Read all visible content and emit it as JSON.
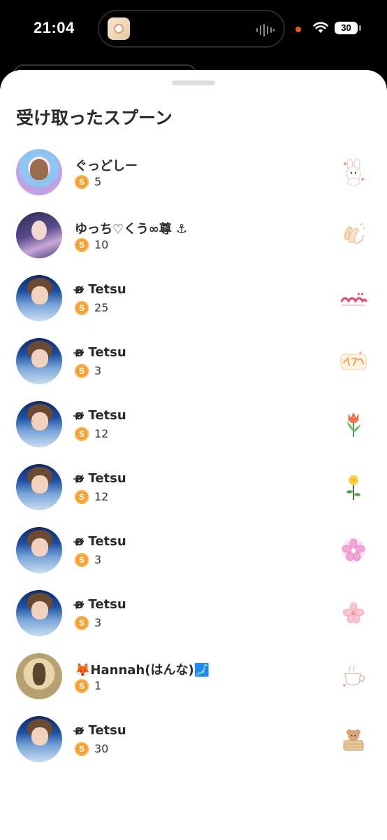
{
  "status_bar": {
    "time": "21:04",
    "battery": "30",
    "icons": [
      "app-icon",
      "audio-wave-icon",
      "recording-dot-icon",
      "wifi-icon",
      "battery-icon"
    ]
  },
  "sheet": {
    "title": "受け取ったスプーン",
    "items": [
      {
        "name": "ぐっどしー",
        "amount": "5",
        "avatar": "otter",
        "sticker": "bunny-sticker"
      },
      {
        "name": "ゆっち♡くう∞尊 ⚓",
        "amount": "10",
        "avatar": "girl",
        "sticker": "clapping-hands-sticker"
      },
      {
        "name": "ʚ̴̶̷̷ Tetsu",
        "amount": "25",
        "avatar": "tetsu",
        "sticker": "kawaii-text-sticker"
      },
      {
        "name": "ʚ̴̶̷̷ Tetsu",
        "amount": "3",
        "avatar": "tetsu",
        "sticker": "kawaii-katakana-sticker"
      },
      {
        "name": "ʚ̴̶̷̷ Tetsu",
        "amount": "12",
        "avatar": "tetsu",
        "sticker": "tulip-sticker"
      },
      {
        "name": "ʚ̴̶̷̷ Tetsu",
        "amount": "12",
        "avatar": "tetsu",
        "sticker": "rose-sticker"
      },
      {
        "name": "ʚ̴̶̷̷ Tetsu",
        "amount": "3",
        "avatar": "tetsu",
        "sticker": "sakura-glow-sticker"
      },
      {
        "name": "ʚ̴̶̷̷ Tetsu",
        "amount": "3",
        "avatar": "tetsu",
        "sticker": "sakura-sticker"
      },
      {
        "name": "🦊Hannah(はんな)🗾",
        "amount": "1",
        "avatar": "hannah",
        "sticker": "teacup-sticker"
      },
      {
        "name": "ʚ̴̶̷̷ Tetsu",
        "amount": "30",
        "avatar": "tetsu",
        "sticker": "poodle-basket-sticker"
      }
    ],
    "coin_label": "S"
  }
}
